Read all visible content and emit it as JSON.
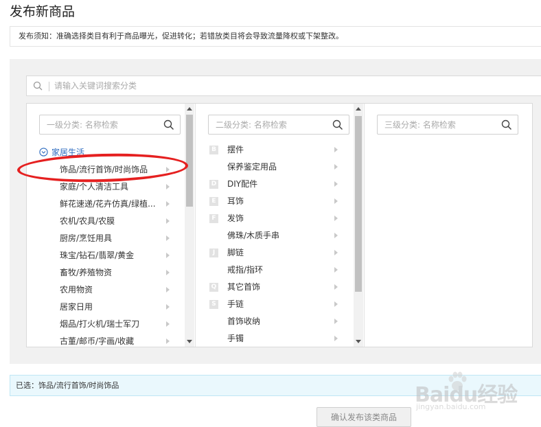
{
  "page": {
    "title": "发布新商品"
  },
  "notice": {
    "text": "发布须知：准确选择类目有利于商品曝光，促进转化；若错放类目将会导致流量降权或下架整改。"
  },
  "search": {
    "placeholder": "请输入关键词搜索分类"
  },
  "level1": {
    "placeholder": "一级分类: 名称检索",
    "group": "家居生活",
    "items": [
      "饰品/流行首饰/时尚饰品",
      "家庭/个人清洁工具",
      "鲜花速递/花卉仿真/绿植...",
      "农机/农具/农膜",
      "厨房/烹饪用具",
      "珠宝/钻石/翡翠/黄金",
      "畜牧/养殖物资",
      "农用物资",
      "居家日用",
      "烟品/打火机/瑞士军刀",
      "古董/邮币/字画/收藏"
    ]
  },
  "level2": {
    "placeholder": "二级分类: 名称检索",
    "items": [
      {
        "letter": "B",
        "label": "摆件"
      },
      {
        "letter": "",
        "label": "保养鉴定用品"
      },
      {
        "letter": "D",
        "label": "DIY配件"
      },
      {
        "letter": "E",
        "label": "耳饰"
      },
      {
        "letter": "F",
        "label": "发饰"
      },
      {
        "letter": "",
        "label": "佛珠/木质手串"
      },
      {
        "letter": "J",
        "label": "脚链"
      },
      {
        "letter": "",
        "label": "戒指/指环"
      },
      {
        "letter": "Q",
        "label": "其它首饰"
      },
      {
        "letter": "S",
        "label": "手链"
      },
      {
        "letter": "",
        "label": "首饰收纳"
      },
      {
        "letter": "",
        "label": "手镯"
      }
    ]
  },
  "level3": {
    "placeholder": "三级分类: 名称检索"
  },
  "selected": {
    "label": "已选：",
    "value": "饰品/流行首饰/时尚饰品"
  },
  "confirm": {
    "label": "确认发布该类商品"
  },
  "watermark": {
    "text": "Baidu经验",
    "sub": "jingyan.baidu.com"
  },
  "colors": {
    "link": "#2d6bbf",
    "highlight": "#e52020",
    "selected_bg": "#eaf8fd"
  }
}
